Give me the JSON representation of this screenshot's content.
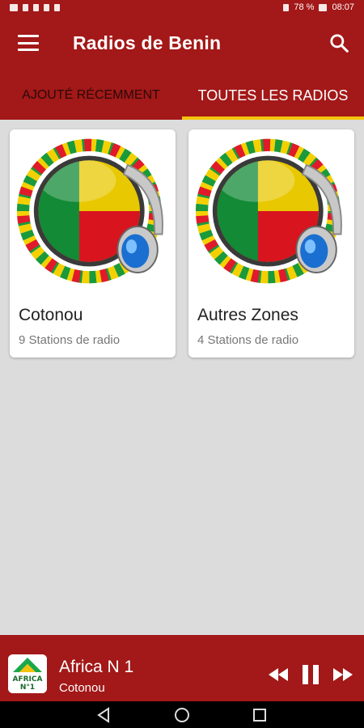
{
  "status_bar": {
    "battery": "78 %",
    "time": "08:07"
  },
  "app_bar": {
    "title": "Radios de Benin"
  },
  "tabs": [
    {
      "label": "AJOUTÉ RÉCEMMENT",
      "active": false
    },
    {
      "label": "TOUTES LES RADIOS",
      "active": true
    }
  ],
  "cards": [
    {
      "title": "Cotonou",
      "subtitle": "9 Stations de radio"
    },
    {
      "title": "Autres Zones",
      "subtitle": "4 Stations de radio"
    }
  ],
  "player": {
    "station": "Africa N 1",
    "location": "Cotonou",
    "logo_text_1": "AFRICA",
    "logo_text_2": "N°1"
  },
  "colors": {
    "primary": "#a31818",
    "accent": "#f4c20d",
    "background": "#dcdcdc"
  },
  "icons": [
    "menu-icon",
    "search-icon",
    "rewind-icon",
    "pause-icon",
    "fast-forward-icon",
    "back-icon",
    "home-icon",
    "recents-icon"
  ]
}
